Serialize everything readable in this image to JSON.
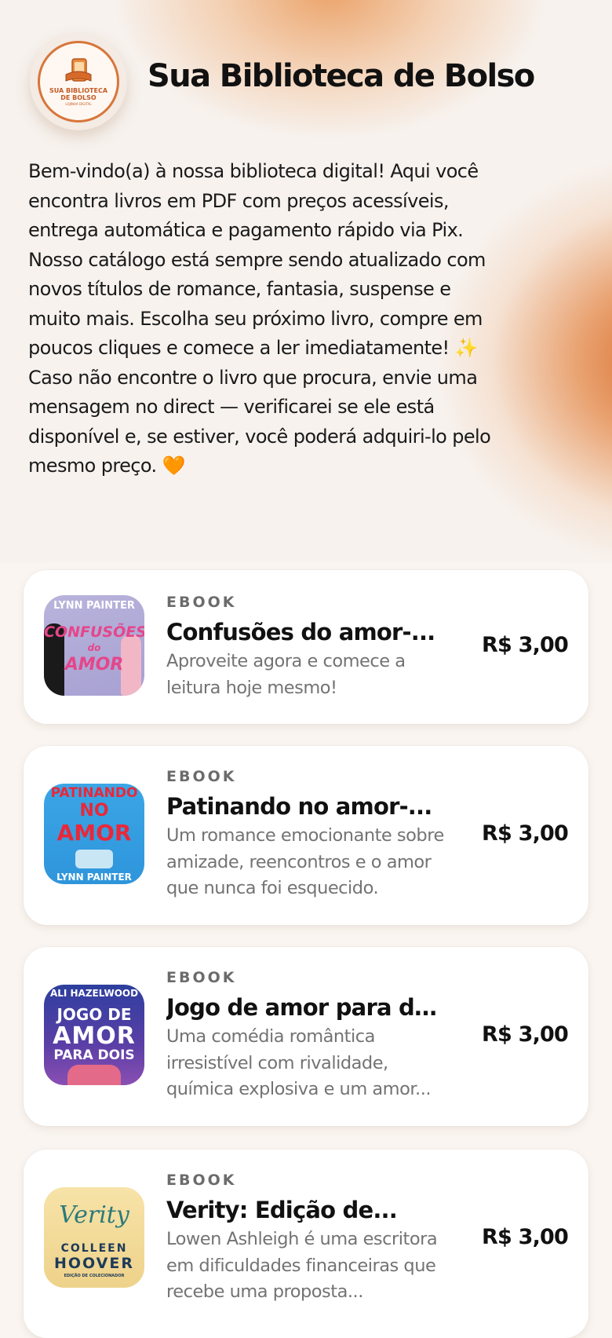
{
  "header": {
    "title": "Sua Biblioteca de Bolso",
    "logo_text": "SUA BIBLIOTECA DE BOLSO",
    "logo_subtext": "LOJINHA DIGITAL",
    "intro": "Bem-vindo(a) à nossa biblioteca digital! Aqui você encontra livros em PDF com preços acessíveis, entrega automática e pagamento rápido via Pix. Nosso catálogo está sempre sendo atualizado com novos títulos de romance, fantasia, suspense e muito mais. Escolha seu próximo livro, compre em poucos cliques e comece a ler imediatamente! ✨ Caso não encontre o livro que procura, envie uma mensagem no direct — verificarei se ele está disponível e, se estiver, você poderá adquiri-lo pelo mesmo preço. 🧡"
  },
  "colors": {
    "accent": "#d8763a",
    "background": "#faf5f1",
    "card": "#ffffff",
    "muted_text": "#737373"
  },
  "products": [
    {
      "kicker": "EBOOK",
      "title": "Confusões do amor-...",
      "description": "Aproveite agora e comece a leitura hoje mesmo!",
      "price": "R$ 3,00",
      "cover": {
        "author": "LYNN PAINTER",
        "line1": "CONFUSÕES",
        "line2": "do",
        "line3": "AMOR"
      }
    },
    {
      "kicker": "EBOOK",
      "title": "Patinando no amor-...",
      "description": "Um romance emocionante sobre amizade, reencontros e o amor que nunca foi esquecido.",
      "price": "R$ 3,00",
      "cover": {
        "line1": "PATINANDO",
        "line2": "NO",
        "line3": "AMOR",
        "author": "LYNN PAINTER"
      }
    },
    {
      "kicker": "EBOOK",
      "title": "Jogo de amor para doi...",
      "description": "Uma comédia romântica irresistível com rivalidade, química explosiva e um amor...",
      "price": "R$ 3,00",
      "cover": {
        "author": "ALI HAZELWOOD",
        "line1": "JOGO DE",
        "line2": "AMOR",
        "line3": "PARA DOIS"
      }
    },
    {
      "kicker": "EBOOK",
      "title": "Verity: Edição de...",
      "description": "Lowen Ashleigh é uma escritora em dificuldades financeiras que recebe uma proposta...",
      "price": "R$ 3,00",
      "cover": {
        "line1": "Verity",
        "line2": "COLLEEN",
        "line3": "HOOVER",
        "author": "EDIÇÃO DE COLECIONADOR"
      }
    }
  ]
}
